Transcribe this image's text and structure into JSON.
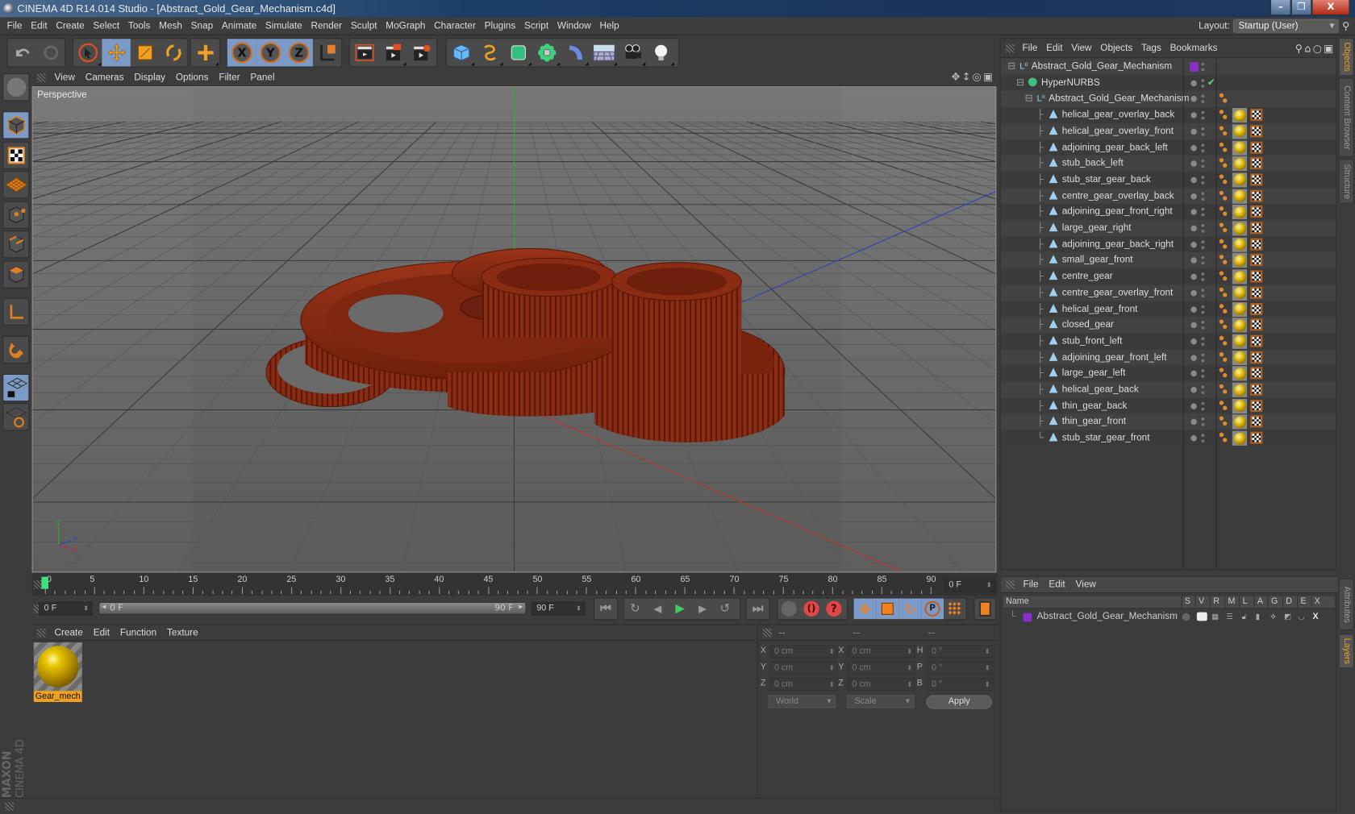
{
  "window": {
    "title": "CINEMA 4D R14.014 Studio - [Abstract_Gold_Gear_Mechanism.c4d]",
    "controls": [
      "minimize",
      "restore",
      "close"
    ]
  },
  "menubar": {
    "items": [
      "File",
      "Edit",
      "Create",
      "Select",
      "Tools",
      "Mesh",
      "Snap",
      "Animate",
      "Simulate",
      "Render",
      "Sculpt",
      "MoGraph",
      "Character",
      "Plugins",
      "Script",
      "Window",
      "Help"
    ],
    "layout_label": "Layout:",
    "layout_value": "Startup (User)"
  },
  "toolbar": {
    "groups": [
      [
        "undo-icon",
        "redo-icon"
      ],
      [
        "live-select-icon",
        "move-icon",
        "scale-icon",
        "rotate-icon"
      ],
      [
        "add-object-icon"
      ],
      [
        "x-axis-icon",
        "y-axis-icon",
        "z-axis-icon",
        "coordinate-system-icon"
      ],
      [
        "render-view-icon",
        "render-picture-viewer-icon",
        "render-settings-icon"
      ],
      [
        "cube-icon",
        "spline-pen-icon",
        "subdivision-surface-icon",
        "cloner-icon",
        "deformer-icon",
        "floor-icon",
        "camera-icon",
        "light-icon"
      ]
    ]
  },
  "left_tools": [
    "make-editable-icon",
    "model-mode-icon",
    "texture-mode-icon",
    "workplane-mode-icon",
    "points-mode-icon",
    "edges-mode-icon",
    "polygons-mode-icon",
    "axis-mode-icon",
    "magnet-icon",
    "locked-workplane-icon",
    "snap-settings-icon"
  ],
  "brand": {
    "line1": "MAXON",
    "line2": "CINEMA 4D"
  },
  "viewport": {
    "menu": [
      "View",
      "Cameras",
      "Display",
      "Options",
      "Filter",
      "Panel"
    ],
    "label": "Perspective",
    "nav_icons": [
      "pan-icon",
      "zoom-icon",
      "orbit-icon",
      "maximize-icon"
    ],
    "axis_labels": {
      "x": "X",
      "y": "Y",
      "z": "Z"
    },
    "colors": {
      "gear": "#8a2a12",
      "x_axis": "#c03030",
      "y_axis": "#30b030",
      "z_axis": "#3040c0"
    }
  },
  "timeline": {
    "ticks": [
      "0",
      "5",
      "10",
      "15",
      "20",
      "25",
      "30",
      "35",
      "40",
      "45",
      "50",
      "55",
      "60",
      "65",
      "70",
      "75",
      "80",
      "85",
      "90"
    ],
    "current_frame_field": "0 F",
    "start_field": "0 F",
    "range_start": "0 F",
    "range_end": "90 F",
    "end_field": "90 F",
    "current_frame": 0,
    "max_frame": 90
  },
  "playback": {
    "buttons": [
      "go-to-start-icon",
      "previous-key-icon",
      "previous-frame-icon",
      "play-icon",
      "next-frame-icon",
      "next-key-icon",
      "go-to-end-icon"
    ],
    "record_buttons": [
      "autokey-icon",
      "record-icon",
      "keyframe-help-icon"
    ],
    "key_buttons": [
      "key-position-icon",
      "key-scale-icon",
      "key-rotation-icon",
      "key-parameter-icon",
      "key-pla-icon"
    ],
    "timeline_button": "timeline-icon"
  },
  "material_manager": {
    "menu": [
      "Create",
      "Edit",
      "Function",
      "Texture"
    ],
    "materials": [
      {
        "name": "Gear_mech"
      }
    ]
  },
  "coordinates": {
    "headers": [
      "--",
      "--",
      "--"
    ],
    "rows": [
      {
        "l1": "X",
        "v1": "0 cm",
        "l2": "X",
        "v2": "0 cm",
        "l3": "H",
        "v3": "0 °"
      },
      {
        "l1": "Y",
        "v1": "0 cm",
        "l2": "Y",
        "v2": "0 cm",
        "l3": "P",
        "v3": "0 °"
      },
      {
        "l1": "Z",
        "v1": "0 cm",
        "l2": "Z",
        "v2": "0 cm",
        "l3": "B",
        "v3": "0 °"
      }
    ],
    "mode": "World",
    "size_mode": "Scale",
    "apply_label": "Apply"
  },
  "object_manager": {
    "menu": [
      "File",
      "Edit",
      "View",
      "Objects",
      "Tags",
      "Bookmarks"
    ],
    "objects": [
      {
        "name": "Abstract_Gold_Gear_Mechanism",
        "type": "null",
        "level": 0,
        "layer_color": "#8a30c8"
      },
      {
        "name": "HyperNURBS",
        "type": "hypernurbs",
        "level": 1,
        "enabled": "✔"
      },
      {
        "name": "Abstract_Gold_Gear_Mechanism",
        "type": "null",
        "level": 2
      },
      {
        "name": "helical_gear_overlay_back",
        "type": "poly",
        "level": 3
      },
      {
        "name": "helical_gear_overlay_front",
        "type": "poly",
        "level": 3
      },
      {
        "name": "adjoining_gear_back_left",
        "type": "poly",
        "level": 3
      },
      {
        "name": "stub_back_left",
        "type": "poly",
        "level": 3
      },
      {
        "name": "stub_star_gear_back",
        "type": "poly",
        "level": 3
      },
      {
        "name": "centre_gear_overlay_back",
        "type": "poly",
        "level": 3
      },
      {
        "name": "adjoining_gear_front_right",
        "type": "poly",
        "level": 3
      },
      {
        "name": "large_gear_right",
        "type": "poly",
        "level": 3
      },
      {
        "name": "adjoining_gear_back_right",
        "type": "poly",
        "level": 3
      },
      {
        "name": "small_gear_front",
        "type": "poly",
        "level": 3
      },
      {
        "name": "centre_gear",
        "type": "poly",
        "level": 3
      },
      {
        "name": "centre_gear_overlay_front",
        "type": "poly",
        "level": 3
      },
      {
        "name": "helical_gear_front",
        "type": "poly",
        "level": 3
      },
      {
        "name": "closed_gear",
        "type": "poly",
        "level": 3
      },
      {
        "name": "stub_front_left",
        "type": "poly",
        "level": 3
      },
      {
        "name": "adjoining_gear_front_left",
        "type": "poly",
        "level": 3
      },
      {
        "name": "large_gear_left",
        "type": "poly",
        "level": 3
      },
      {
        "name": "helical_gear_back",
        "type": "poly",
        "level": 3
      },
      {
        "name": "thin_gear_back",
        "type": "poly",
        "level": 3
      },
      {
        "name": "thin_gear_front",
        "type": "poly",
        "level": 3
      },
      {
        "name": "stub_star_gear_front",
        "type": "poly",
        "level": 3
      }
    ]
  },
  "right_tabs": {
    "top": [
      "Objects",
      "Content Browser",
      "Structure"
    ],
    "bottom": [
      "Attributes",
      "Layers"
    ]
  },
  "layer_manager": {
    "menu": [
      "File",
      "Edit",
      "View"
    ],
    "columns": [
      "Name",
      "S",
      "V",
      "R",
      "M",
      "L",
      "A",
      "G",
      "D",
      "E",
      "X"
    ],
    "layers": [
      {
        "name": "Abstract_Gold_Gear_Mechanism",
        "color": "#8a30c8"
      }
    ]
  }
}
